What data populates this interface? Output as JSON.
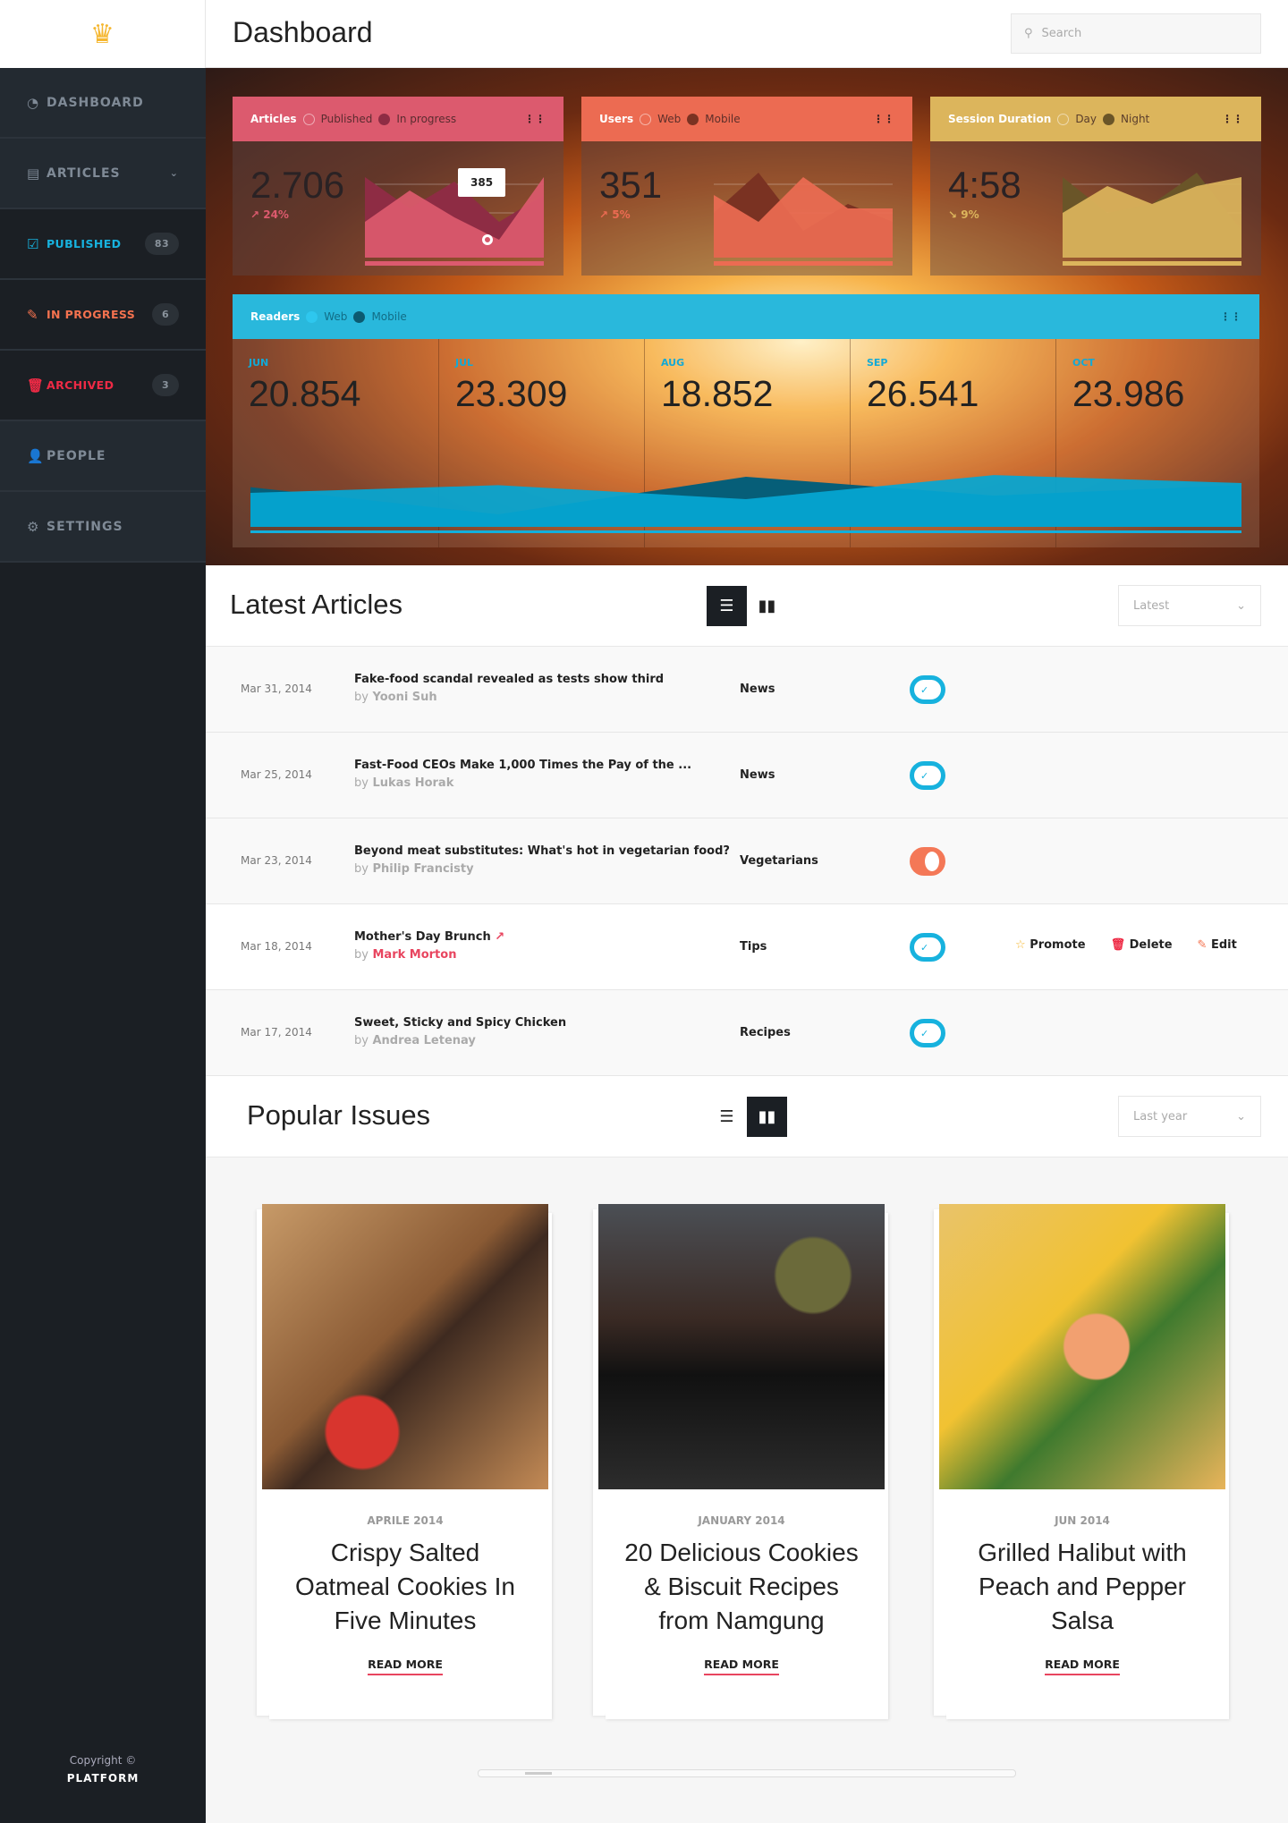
{
  "app": {
    "title": "Dashboard",
    "search_placeholder": "Search",
    "logo_icon": "crown-icon",
    "copyright": "Copyright ©",
    "brand": "PLATFORM"
  },
  "sidebar": {
    "items": [
      {
        "label": "DASHBOARD",
        "icon": "pie-chart-icon"
      },
      {
        "label": "ARTICLES",
        "icon": "document-icon",
        "chevron": "chevron-down-icon"
      },
      {
        "label": "PUBLISHED",
        "icon": "checkbox-icon",
        "count": "83",
        "color": "#17b2de"
      },
      {
        "label": "IN PROGRESS",
        "icon": "edit-icon",
        "count": "6",
        "color": "#f4724f"
      },
      {
        "label": "ARCHIVED",
        "icon": "trash-icon",
        "count": "3",
        "color": "#ee2a45"
      },
      {
        "label": "PEOPLE",
        "icon": "person-icon"
      },
      {
        "label": "SETTINGS",
        "icon": "gear-icon"
      }
    ]
  },
  "stats": [
    {
      "title": "Articles",
      "legend": [
        "Published",
        "In progress"
      ],
      "value": "2.706",
      "change": "↗ 24%",
      "color": "#dc5a6e",
      "dark": "#8e2c44",
      "tooltip": "385"
    },
    {
      "title": "Users",
      "legend": [
        "Web",
        "Mobile"
      ],
      "value": "351",
      "change": "↗ 5%",
      "color": "#ec6b52",
      "dark": "#7a3222"
    },
    {
      "title": "Session Duration",
      "legend": [
        "Day",
        "Night"
      ],
      "value": "4:58",
      "change": "↘ 9%",
      "color": "#dcb55c",
      "dark": "#6a5528"
    }
  ],
  "readers": {
    "title": "Readers",
    "legend": [
      "Web",
      "Mobile"
    ],
    "color": "#29b8dc",
    "months": [
      {
        "m": "JUN",
        "v": "20.854"
      },
      {
        "m": "JUL",
        "v": "23.309"
      },
      {
        "m": "AUG",
        "v": "18.852"
      },
      {
        "m": "SEP",
        "v": "26.541"
      },
      {
        "m": "OCT",
        "v": "23.986"
      }
    ]
  },
  "chart_data": [
    {
      "type": "area",
      "series": [
        {
          "name": "Published",
          "values": [
            40,
            75,
            45,
            20,
            90
          ]
        },
        {
          "name": "In progress",
          "values": [
            90,
            55,
            85,
            40,
            70
          ]
        }
      ]
    },
    {
      "type": "area",
      "series": [
        {
          "name": "Web",
          "values": [
            70,
            40,
            90,
            55,
            55
          ]
        },
        {
          "name": "Mobile",
          "values": [
            50,
            95,
            30,
            60,
            40
          ]
        }
      ]
    },
    {
      "type": "area",
      "series": [
        {
          "name": "Day",
          "values": [
            50,
            80,
            60,
            80,
            90
          ]
        },
        {
          "name": "Night",
          "values": [
            90,
            50,
            60,
            95,
            30
          ]
        }
      ]
    },
    {
      "type": "area",
      "categories": [
        "JUN",
        "JUL",
        "AUG",
        "SEP",
        "OCT"
      ],
      "series": [
        {
          "name": "Web",
          "values": [
            20.854,
            23.309,
            18.852,
            26.541,
            23.986
          ]
        },
        {
          "name": "Mobile",
          "values": [
            24,
            11,
            29,
            20,
            25
          ]
        }
      ]
    }
  ],
  "latest": {
    "title": "Latest Articles",
    "filter": "Latest",
    "rows": [
      {
        "date": "Mar 31, 2014",
        "title": "Fake-food scandal revealed as tests show third",
        "by": "by",
        "author": "Yooni Suh",
        "category": "News",
        "on": true
      },
      {
        "date": "Mar 25, 2014",
        "title": "Fast-Food CEOs Make 1,000 Times the Pay of the ...",
        "by": "by",
        "author": "Lukas Horak",
        "category": "News",
        "on": true
      },
      {
        "date": "Mar 23, 2014",
        "title": "Beyond meat substitutes: What's hot in vegetarian food?",
        "by": "by",
        "author": "Philip Francisty",
        "category": "Vegetarians",
        "on": false
      },
      {
        "date": "Mar 18, 2014",
        "title": "Mother's Day Brunch",
        "by": "by",
        "author": "Mark Morton",
        "category": "Tips",
        "on": true
      },
      {
        "date": "Mar 17, 2014",
        "title": "Sweet, Sticky and Spicy Chicken",
        "by": "by",
        "author": "Andrea Letenay",
        "category": "Recipes",
        "on": true
      }
    ],
    "actions": [
      "Promote",
      "Delete",
      "Edit"
    ]
  },
  "popular": {
    "title": "Popular Issues",
    "filter": "Last year",
    "cards": [
      {
        "month": "APRILE 2014",
        "title": "Crispy Salted Oatmeal Cookies In Five Minutes",
        "cta": "READ MORE"
      },
      {
        "month": "JANUARY 2014",
        "title": "20 Delicious Cookies & Biscuit Recipes from Namgung",
        "cta": "READ MORE"
      },
      {
        "month": "JUN 2014",
        "title": "Grilled Halibut with Peach and Pepper Salsa",
        "cta": "READ MORE"
      }
    ]
  }
}
